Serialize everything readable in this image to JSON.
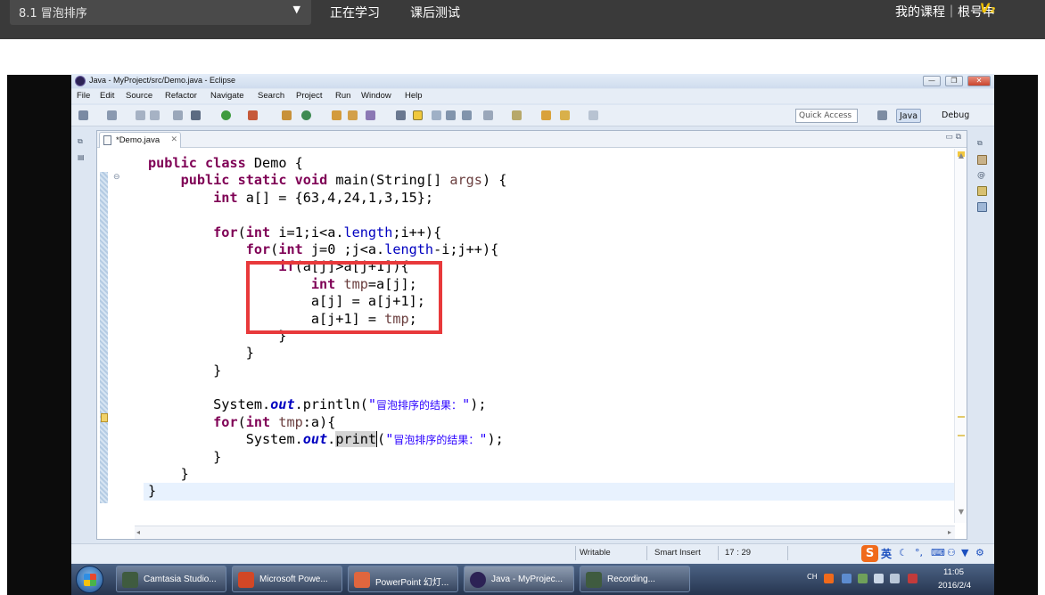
{
  "topbar": {
    "course_title": "8.1 冒泡排序",
    "tabs": [
      "正在学习",
      "课后测试"
    ],
    "right_links": "我的课程｜根号申",
    "logo_text": "V₂"
  },
  "window": {
    "title": "Java - MyProject/src/Demo.java - Eclipse",
    "controls": [
      "minimize",
      "restore",
      "close"
    ]
  },
  "menu": [
    "File",
    "Edit",
    "Source",
    "Refactor",
    "Navigate",
    "Search",
    "Project",
    "Run",
    "Window",
    "Help"
  ],
  "toolbar": {
    "quick_access_placeholder": "Quick Access",
    "perspectives": [
      "Java",
      "Debug"
    ]
  },
  "editor": {
    "tab_label": "*Demo.java",
    "code_lines": [
      "public class Demo {",
      "    public static void main(String[] args) {",
      "        int a[] = {63,4,24,1,3,15};",
      "",
      "        for(int i=1;i<a.length;i++){",
      "            for(int j=0 ;j<a.length-i;j++){",
      "                if(a[j]>a[j+1]){",
      "                    int tmp=a[j];",
      "                    a[j] = a[j+1];",
      "                    a[j+1] = tmp;",
      "                }",
      "            }",
      "        }",
      "",
      "        System.out.println(\"冒泡排序的结果：\");",
      "        for(int tmp:a){",
      "            System.out.print(\"冒泡排序的结果：\");",
      "        }",
      "    }",
      "}"
    ],
    "highlight_color": "#e8393b"
  },
  "statusbar": {
    "writable": "Writable",
    "insert_mode": "Smart Insert",
    "cursor_position": "17 : 29"
  },
  "ime": {
    "logo": "S",
    "mode": "英"
  },
  "taskbar": {
    "tasks": [
      "Camtasia Studio...",
      "Microsoft Powe...",
      "PowerPoint 幻灯...",
      "Java - MyProjec...",
      "Recording..."
    ],
    "tray_lang": "CH",
    "clock_time": "11:05",
    "clock_date": "2016/2/4"
  }
}
